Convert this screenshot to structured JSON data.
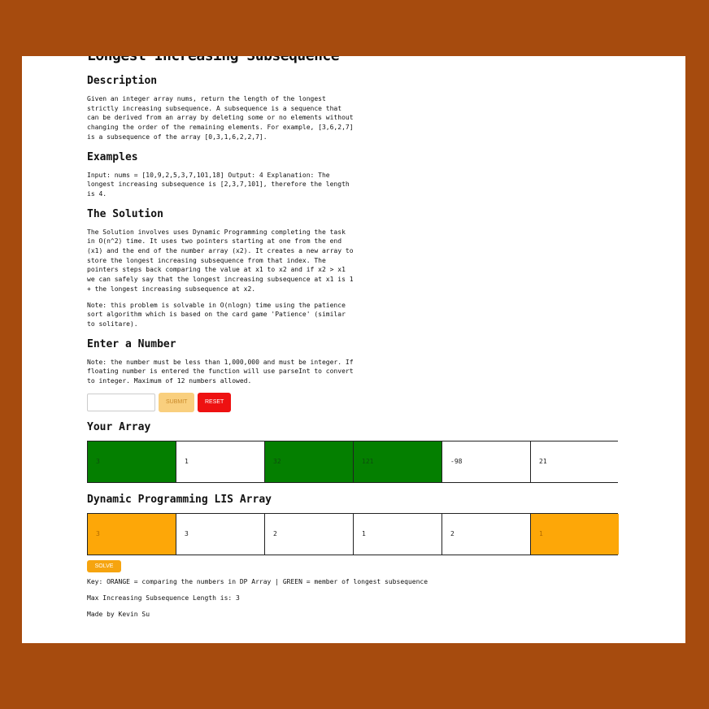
{
  "title": "Longest Increasing Subsequence",
  "description": {
    "heading": "Description",
    "text": "Given an integer array nums, return the length of the longest strictly increasing subsequence. A subsequence is a sequence that can be derived from an array by deleting some or no elements without changing the order of the remaining elements. For example, [3,6,2,7] is a subsequence of the array [0,3,1,6,2,2,7]."
  },
  "examples": {
    "heading": "Examples",
    "text": "Input: nums = [10,9,2,5,3,7,101,18] Output: 4 Explanation: The longest increasing subsequence is [2,3,7,101], therefore the length is 4."
  },
  "solution": {
    "heading": "The Solution",
    "text": "The Solution involves uses Dynamic Programming completing the task in O(n^2) time. It uses two pointers starting at one from the end (x1) and the end of the number array (x2). It creates a new array to store the longest increasing subsequence from that index. The pointers steps back comparing the value at x1 to x2 and if x2 > x1 we can safely say that the longest increasing subsequence at x1 is 1 + the longest increasing subsequence at x2.",
    "note": "Note: this problem is solvable in O(nlogn) time using the patience sort algorithm which is based on the card game 'Patience' (similar to solitare)."
  },
  "enter": {
    "heading": "Enter a Number",
    "note": "Note: the number must be less than 1,000,000 and must be integer. If floating number is entered the function will use parseInt to convert to integer. Maximum of 12 numbers allowed.",
    "input_value": "",
    "submit_label": "SUBMIT",
    "reset_label": "RESET"
  },
  "your_array": {
    "heading": "Your Array",
    "cells": [
      {
        "value": "3",
        "state": "green"
      },
      {
        "value": "1",
        "state": "white"
      },
      {
        "value": "32",
        "state": "green"
      },
      {
        "value": "121",
        "state": "green"
      },
      {
        "value": "-98",
        "state": "white"
      },
      {
        "value": "21",
        "state": "white"
      }
    ]
  },
  "dp_array": {
    "heading": "Dynamic Programming LIS Array",
    "cells": [
      {
        "value": "3",
        "state": "orange"
      },
      {
        "value": "3",
        "state": "white"
      },
      {
        "value": "2",
        "state": "white"
      },
      {
        "value": "1",
        "state": "white"
      },
      {
        "value": "2",
        "state": "white"
      },
      {
        "value": "1",
        "state": "orange"
      }
    ]
  },
  "solve_label": "SOLVE",
  "key_text": "Key: ORANGE = comparing the numbers in DP Array | GREEN = member of longest subsequence",
  "max_text": "Max Increasing Subsequence Length is: 3",
  "credit_text": "Made by Kevin Su",
  "colors": {
    "green": "#047f00",
    "orange": "#fda708",
    "reset": "#ee1111",
    "submit": "#f9cf7e",
    "frame": "#a64b0e"
  }
}
